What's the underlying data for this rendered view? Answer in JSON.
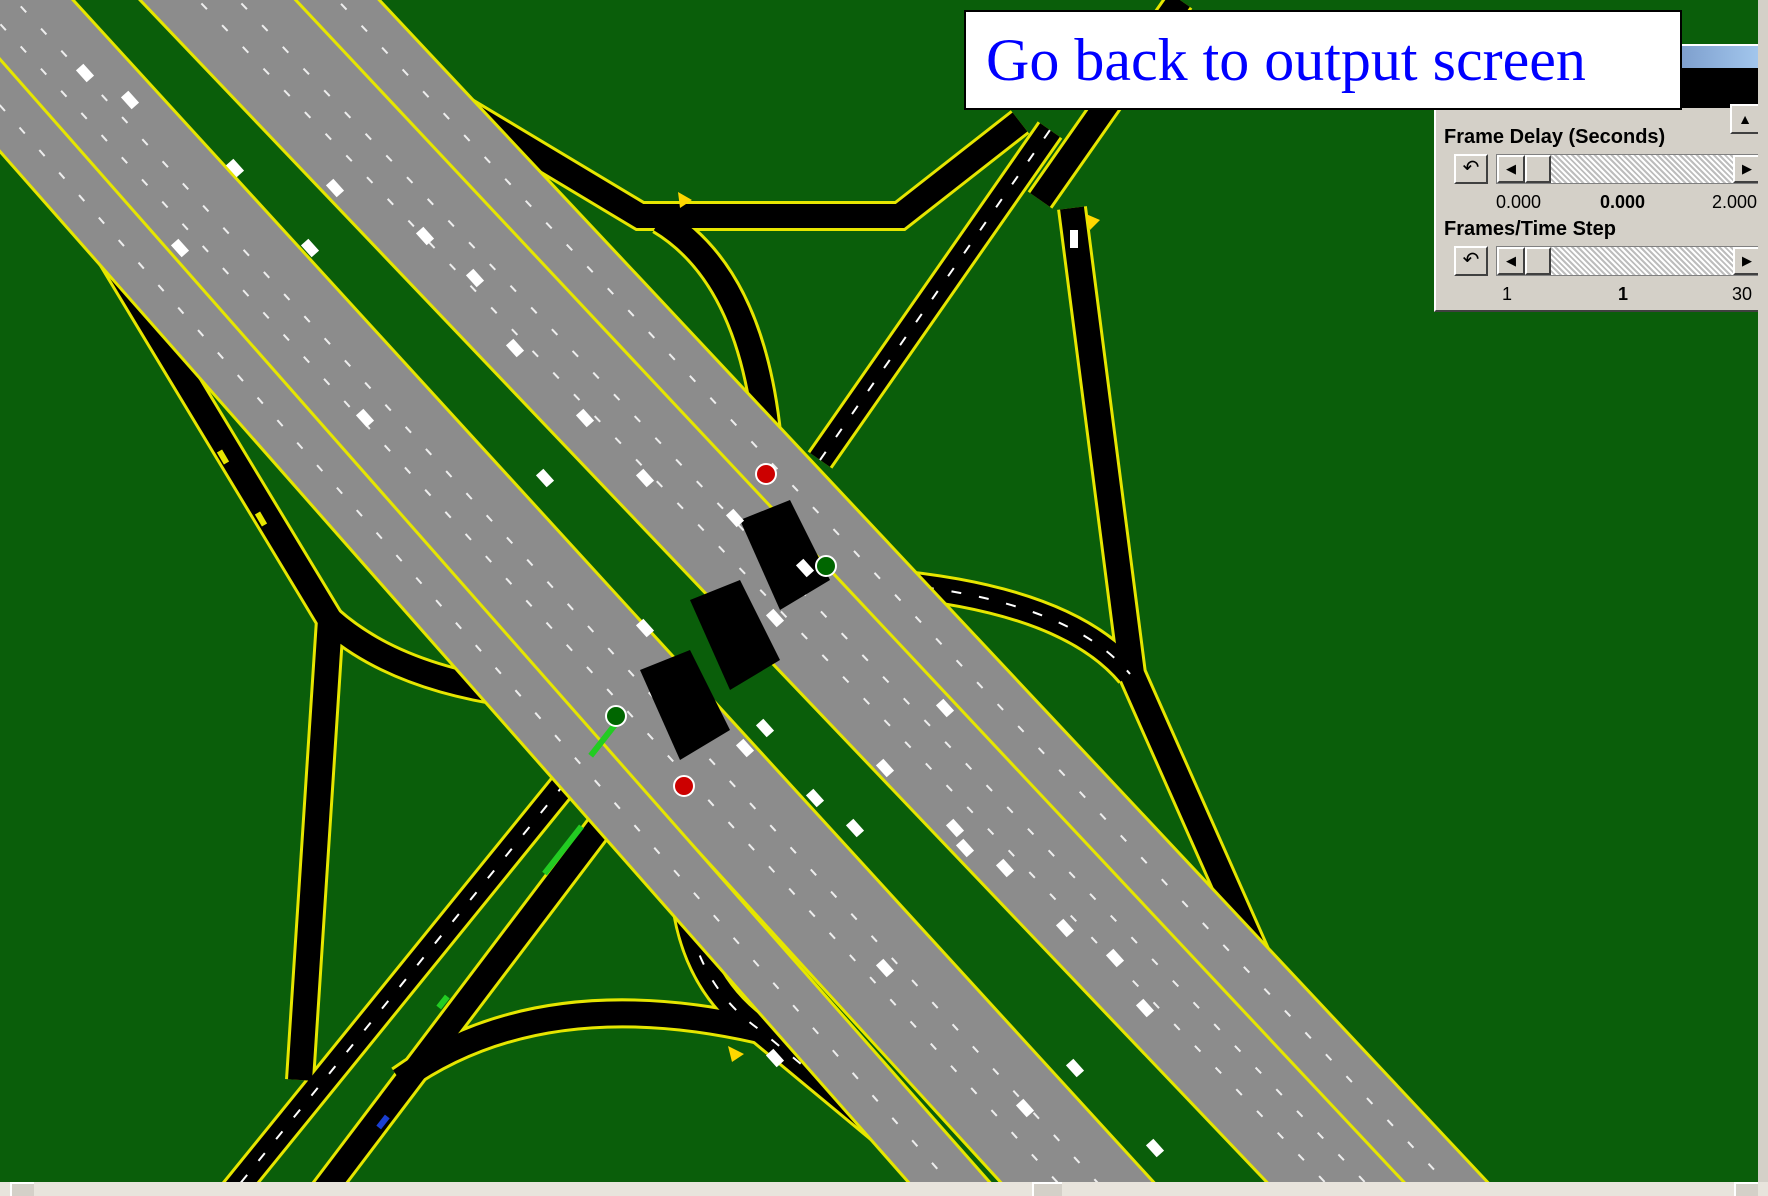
{
  "callout": {
    "text": "Go back to output screen",
    "color": "#0000ff"
  },
  "panel": {
    "frame_delay": {
      "label": "Frame Delay (Seconds)",
      "min_label": "0.000",
      "current_label": "0.000",
      "max_label": "2.000",
      "value": 0.0,
      "min": 0.0,
      "max": 2.0
    },
    "frames_per_step": {
      "label": "Frames/Time Step",
      "min_label": "1",
      "current_label": "1",
      "max_label": "30",
      "value": 1,
      "min": 1,
      "max": 30
    },
    "icons": {
      "reset": "reset-icon",
      "left_arrow": "left-arrow-icon",
      "right_arrow": "right-arrow-icon",
      "up_arrow": "up-arrow-icon"
    }
  },
  "scene": {
    "type": "freeway interchange traffic animation",
    "background_color": "#0a5e0a",
    "freeway_color": "#8c8c8c",
    "ramp_color": "#000000",
    "edge_line_color": "#e6e600",
    "vehicle_color": "#ffffff",
    "signal_colors": [
      "#cc0000",
      "#009900"
    ],
    "yield_marker_color": "#ffd700"
  }
}
